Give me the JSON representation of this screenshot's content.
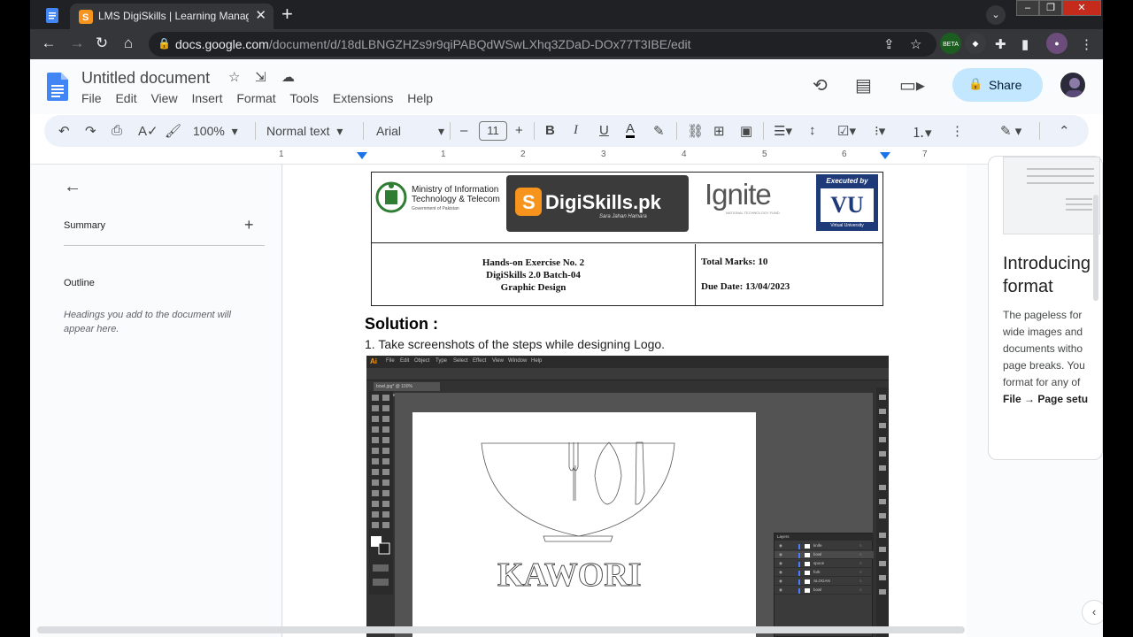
{
  "browser": {
    "tab_title": "LMS DigiSkills | Learning Manage",
    "tab_close": "✕",
    "new_tab": "+",
    "url_domain": "docs.google.com",
    "url_path": "/document/d/18dLBNGZHZs9r9qiPABQdWSwLXhq3ZDaD-DOx77T3IBE/edit",
    "beta_badge": "BETA"
  },
  "docs": {
    "title": "Untitled document",
    "menu": [
      "File",
      "Edit",
      "View",
      "Insert",
      "Format",
      "Tools",
      "Extensions",
      "Help"
    ],
    "share_label": "Share"
  },
  "toolbar": {
    "zoom": "100%",
    "style": "Normal text",
    "font": "Arial",
    "font_size": "11",
    "ruler_numbers": [
      "1",
      "1",
      "2",
      "3",
      "4",
      "5",
      "6",
      "7"
    ]
  },
  "outline": {
    "summary_label": "Summary",
    "outline_label": "Outline",
    "hint": "Headings you add to the document will appear here."
  },
  "document": {
    "logos": {
      "ministry": "Ministry of Information Technology & Telecom",
      "ministry_sub": "Government of Pakistan",
      "digiskills": "DigiSkills.pk",
      "digiskills_sub": "Sara Jahan Hamara",
      "ignite": "Ignite",
      "ignite_sub": "NATIONAL TECHNOLOGY FUND",
      "vu_executed": "Executed by",
      "vu_mark": "VU",
      "vu_name": "Virtual University"
    },
    "exercise_title": "Hands-on Exercise No. 2",
    "batch": "DigiSkills 2.0 Batch-04",
    "course": "Graphic Design",
    "total_marks": "Total Marks: 10",
    "due_date": "Due Date: 13/04/2023",
    "solution_heading": "Solution :",
    "step_1": "1.  Take screenshots of the steps while designing Logo."
  },
  "illustrator": {
    "menu": [
      "File",
      "Edit",
      "Object",
      "Type",
      "Select",
      "Effect",
      "View",
      "Window",
      "Help"
    ],
    "doc_tab": "bowl.jpg* @ 100% (RGB/Preview)",
    "logo_text": "KAWORI",
    "layers_title": "Layers",
    "layers": [
      "knife",
      "bowl",
      "spoon",
      "fork",
      "SLOGAN",
      "bowl"
    ]
  },
  "sidebar": {
    "card_title_1": "Introducing",
    "card_title_2": "format",
    "card_lines": [
      "The pageless for",
      "wide images and",
      "documents witho",
      "page breaks. You",
      "format for any of"
    ],
    "card_link": "File → Page setu"
  }
}
